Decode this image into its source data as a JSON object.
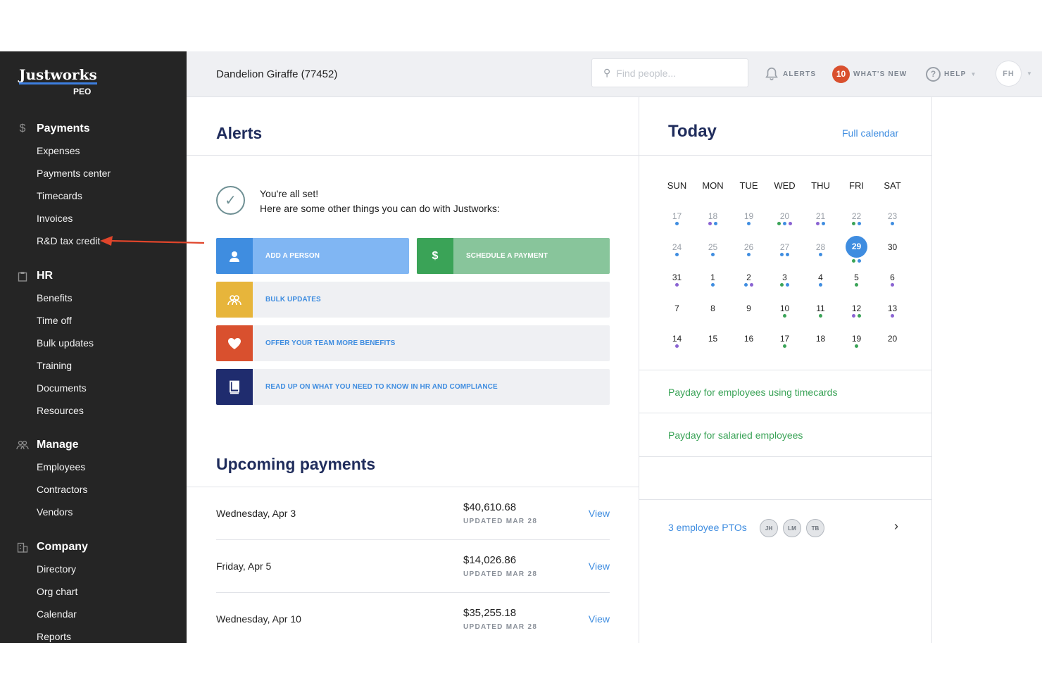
{
  "logo": {
    "name": "Justworks",
    "sub": "PEO"
  },
  "sidebar": {
    "sections": [
      {
        "label": "Payments",
        "icon": "dollar-icon",
        "items": [
          "Expenses",
          "Payments center",
          "Timecards",
          "Invoices",
          "R&D tax credit"
        ]
      },
      {
        "label": "HR",
        "icon": "clipboard-icon",
        "items": [
          "Benefits",
          "Time off",
          "Bulk updates",
          "Training",
          "Documents",
          "Resources"
        ]
      },
      {
        "label": "Manage",
        "icon": "people-icon",
        "items": [
          "Employees",
          "Contractors",
          "Vendors"
        ]
      },
      {
        "label": "Company",
        "icon": "building-icon",
        "items": [
          "Directory",
          "Org chart",
          "Calendar",
          "Reports"
        ]
      }
    ]
  },
  "topbar": {
    "company": "Dandelion Giraffe (77452)",
    "search_placeholder": "Find people...",
    "alerts_label": "ALERTS",
    "whatsnew_count": "10",
    "whatsnew_label": "WHAT'S NEW",
    "help_label": "HELP",
    "help_glyph": "?",
    "avatar_initials": "FH"
  },
  "alerts": {
    "title": "Alerts",
    "line1": "You're all set!",
    "line2": "Here are some other things you can do with Justworks:",
    "actions": [
      {
        "label": "ADD A PERSON",
        "icon": "person-icon",
        "accent": "#3f8de0",
        "bg": "#80b6f3",
        "text_color": "#ffffff"
      },
      {
        "label": "SCHEDULE A PAYMENT",
        "icon": "dollar-icon",
        "glyph": "$",
        "accent": "#3aa357",
        "bg": "#88c59b",
        "text_color": "#ffffff"
      },
      {
        "label": "BULK UPDATES",
        "icon": "people-icon",
        "accent": "#e7b53b",
        "bg": "#eff0f3",
        "text_color": "#3f8de0"
      },
      {
        "label": "OFFER YOUR TEAM MORE BENEFITS",
        "icon": "heart-icon",
        "accent": "#d9502e",
        "bg": "#eff0f3",
        "text_color": "#3f8de0"
      },
      {
        "label": "READ UP ON WHAT YOU NEED TO KNOW IN HR AND COMPLIANCE",
        "icon": "book-icon",
        "accent": "#1f2c6e",
        "bg": "#eff0f3",
        "text_color": "#3f8de0"
      }
    ]
  },
  "payments": {
    "title": "Upcoming payments",
    "rows": [
      {
        "date": "Wednesday, Apr 3",
        "amount": "$40,610.68",
        "updated": "UPDATED MAR 28",
        "link": "View"
      },
      {
        "date": "Friday, Apr 5",
        "amount": "$14,026.86",
        "updated": "UPDATED MAR 28",
        "link": "View"
      },
      {
        "date": "Wednesday, Apr 10",
        "amount": "$35,255.18",
        "updated": "UPDATED MAR 28",
        "link": "View"
      }
    ]
  },
  "today": {
    "title": "Today",
    "full_calendar": "Full calendar",
    "weekdays": [
      "SUN",
      "MON",
      "TUE",
      "WED",
      "THU",
      "FRI",
      "SAT"
    ],
    "dot_colors": {
      "b": "#3f8de0",
      "g": "#3aa357",
      "p": "#8a63d2"
    },
    "weeks": [
      [
        {
          "d": "17",
          "s": "past",
          "dots": "b"
        },
        {
          "d": "18",
          "s": "past",
          "dots": "pb"
        },
        {
          "d": "19",
          "s": "past",
          "dots": "b"
        },
        {
          "d": "20",
          "s": "past",
          "dots": "gbp"
        },
        {
          "d": "21",
          "s": "past",
          "dots": "pb"
        },
        {
          "d": "22",
          "s": "past",
          "dots": "gb"
        },
        {
          "d": "23",
          "s": "past",
          "dots": "b"
        }
      ],
      [
        {
          "d": "24",
          "s": "past",
          "dots": "b"
        },
        {
          "d": "25",
          "s": "past",
          "dots": "b"
        },
        {
          "d": "26",
          "s": "past",
          "dots": "b"
        },
        {
          "d": "27",
          "s": "past",
          "dots": "bb"
        },
        {
          "d": "28",
          "s": "past",
          "dots": "b"
        },
        {
          "d": "29",
          "s": "today",
          "dots": "gb"
        },
        {
          "d": "30",
          "s": "future",
          "dots": ""
        }
      ],
      [
        {
          "d": "31",
          "s": "future",
          "dots": "p"
        },
        {
          "d": "1",
          "s": "future",
          "dots": "b"
        },
        {
          "d": "2",
          "s": "future",
          "dots": "bp"
        },
        {
          "d": "3",
          "s": "future",
          "dots": "gb"
        },
        {
          "d": "4",
          "s": "future",
          "dots": "b"
        },
        {
          "d": "5",
          "s": "future",
          "dots": "g"
        },
        {
          "d": "6",
          "s": "future",
          "dots": "p"
        }
      ],
      [
        {
          "d": "7",
          "s": "future",
          "dots": ""
        },
        {
          "d": "8",
          "s": "future",
          "dots": ""
        },
        {
          "d": "9",
          "s": "future",
          "dots": ""
        },
        {
          "d": "10",
          "s": "future",
          "dots": "g"
        },
        {
          "d": "11",
          "s": "future",
          "dots": "g"
        },
        {
          "d": "12",
          "s": "future",
          "dots": "pg"
        },
        {
          "d": "13",
          "s": "future",
          "dots": "p"
        }
      ],
      [
        {
          "d": "14",
          "s": "future",
          "dots": "p"
        },
        {
          "d": "15",
          "s": "future",
          "dots": ""
        },
        {
          "d": "16",
          "s": "future",
          "dots": ""
        },
        {
          "d": "17",
          "s": "future",
          "dots": "g"
        },
        {
          "d": "18",
          "s": "future",
          "dots": ""
        },
        {
          "d": "19",
          "s": "future",
          "dots": "g"
        },
        {
          "d": "20",
          "s": "future",
          "dots": ""
        }
      ]
    ],
    "events": [
      "Payday for employees using timecards",
      "Payday for salaried employees"
    ],
    "pto_label": "3 employee PTOs",
    "pto_avatars": [
      "JH",
      "LM",
      "TB"
    ]
  },
  "colors": {
    "annotation_arrow": "#e0452b"
  }
}
